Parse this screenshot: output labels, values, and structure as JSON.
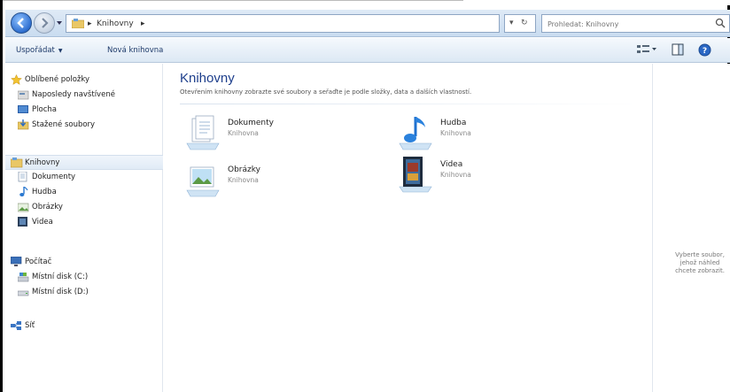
{
  "address": {
    "breadcrumb": [
      "Knihovny"
    ],
    "search_placeholder": "Prohledat: Knihovny"
  },
  "toolbar": {
    "organize_label": "Uspořádat",
    "new_library_label": "Nová knihovna"
  },
  "nav": {
    "favorites": {
      "header": "Oblíbené položky",
      "items": [
        "Naposledy navštívené",
        "Plocha",
        "Stažené soubory"
      ]
    },
    "libraries": {
      "header": "Knihovny",
      "items": [
        "Dokumenty",
        "Hudba",
        "Obrázky",
        "Videa"
      ]
    },
    "computer": {
      "header": "Počítač",
      "items": [
        "Místní disk (C:)",
        "Místní disk (D:)"
      ]
    },
    "network": {
      "header": "Síť"
    }
  },
  "main": {
    "title": "Knihovny",
    "subtitle": "Otevřením knihovny zobrazte své soubory a seřaďte je podle složky, data a dalších vlastností.",
    "tiles": [
      {
        "name": "Dokumenty",
        "type": "Knihovna"
      },
      {
        "name": "Hudba",
        "type": "Knihovna"
      },
      {
        "name": "Obrázky",
        "type": "Knihovna"
      },
      {
        "name": "Videa",
        "type": "Knihovna"
      }
    ]
  },
  "preview": {
    "message_lines": [
      "Vyberte soubor,",
      "jehož náhled",
      "chcete zobrazit."
    ]
  }
}
